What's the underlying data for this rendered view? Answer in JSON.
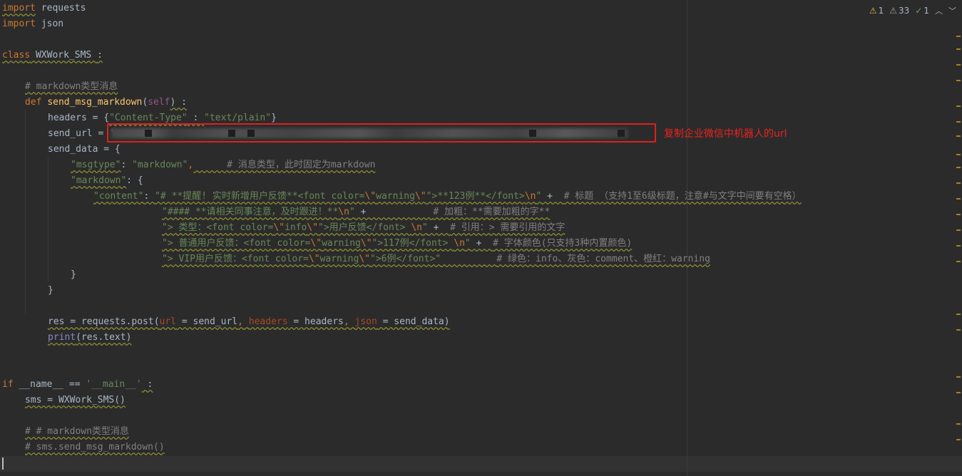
{
  "code": {
    "l1_kw": "import",
    "l1_rest": " requests",
    "l2_kw": "import",
    "l2_rest": " json",
    "l4_kw": "class",
    "l4_name": " WXWork_SMS ",
    "l4_colon": ":",
    "l6_cmt": "# markdown类型消息",
    "l7_kw": "def",
    "l7_fn": "send_msg_markdown",
    "l7_open": "(",
    "l7_self": "self",
    "l7_close": ") :",
    "l8_a": "headers = {",
    "l8_s1": "\"Content-Type\"",
    "l8_b": " : ",
    "l8_s2": "\"text/plain\"",
    "l8_c": "}",
    "l9_a": "send_url = ",
    "l9_s": "'",
    "l10_a": "send_data = {",
    "l11_s": "\"msgtype\"",
    "l11_b": ": ",
    "l11_v": "\"markdown\"",
    "l11_comma": ",",
    "l11_c": "      # 消息类型，此时固定为markdown",
    "l12_s": "\"markdown\"",
    "l12_b": ": {",
    "l13_s": "\"content\"",
    "l13_b": ": ",
    "l13_v1": "\"# **提醒! 实时新增用户反馈**<font color=",
    "l13_e1": "\\\"",
    "l13_v2": "warning",
    "l13_e2": "\\\"",
    "l13_v3": "\">**123例**</font>",
    "l13_e3": "\\n",
    "l13_v4": "\"",
    "l13_plus": " +  ",
    "l13_c": "# 标题 （支持1至6级标题，注意#与文字中间要有空格）",
    "l14_v1": "\"#### **请相关同事注意，及时跟进！**",
    "l14_e": "\\n",
    "l14_v2": "\"",
    "l14_plus": " +            ",
    "l14_c": "# 加粗：**需要加粗的字**",
    "l15_v1": "\"> 类型：<font color=",
    "l15_e1": "\\\"",
    "l15_v2": "info",
    "l15_e2": "\\\"",
    "l15_v3": "\">用户反馈</font> ",
    "l15_e3": "\\n",
    "l15_v4": "\"",
    "l15_plus": " +  ",
    "l15_c": "# 引用：> 需要引用的文字",
    "l16_v1": "\"> 普通用户反馈：<font color=",
    "l16_e1": "\\\"",
    "l16_v2": "warning",
    "l16_e2": "\\\"",
    "l16_v3": "\">117例</font> ",
    "l16_e3": "\\n",
    "l16_v4": "\"",
    "l16_plus": " +  ",
    "l16_c": "# 字体颜色(只支持3种内置颜色)",
    "l17_v1": "\"> VIP用户反馈：<font color=",
    "l17_e1": "\\\"",
    "l17_v2": "warning",
    "l17_e2": "\\\"",
    "l17_v3": "\">6例</font>\"",
    "l17_pad": "          ",
    "l17_c": "# 绿色：info、灰色：comment、橙红：warning",
    "l18": "}",
    "l19": "}",
    "l21_a": "res = requests.post(",
    "l21_p1": "url",
    "l21_b": " = send_url",
    "l21_cm1": ",",
    "l21_sp1": " ",
    "l21_p2": "headers",
    "l21_c": " = headers",
    "l21_cm2": ",",
    "l21_sp2": " ",
    "l21_p3": "json",
    "l21_d": " = send_data)",
    "l22_fn": "print",
    "l22_rest": "(res.text)",
    "l25_kw": "if",
    "l25_a": " __name__ == ",
    "l25_s": "'__main__'",
    "l25_c": " :",
    "l26": "sms = WXWork_SMS()",
    "l28_cmt": "# # markdown类型消息",
    "l29_cmt": "# sms.send_msg_markdown()"
  },
  "annotation": "复制企业微信中机器人的url",
  "inspections": {
    "errors": "1",
    "warnings": "33",
    "typos": "1"
  },
  "colors": {
    "background": "#2b2b2b",
    "keyword": "#cc7832",
    "string": "#6a8759",
    "comment": "#808080",
    "function": "#ffc66d",
    "annotation_red": "#e8231e"
  }
}
